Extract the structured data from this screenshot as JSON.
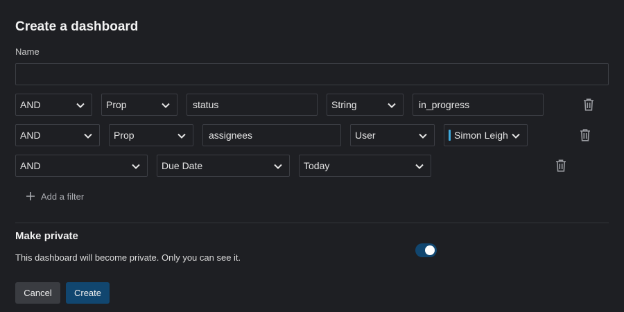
{
  "dialog": {
    "title": "Create a dashboard",
    "name_label": "Name",
    "name_value": "",
    "name_placeholder": ""
  },
  "filters": [
    {
      "conjunction": "AND",
      "kind": "Prop",
      "property": "status",
      "type": "String",
      "value": "in_progress"
    },
    {
      "conjunction": "AND",
      "kind": "Prop",
      "property": "assignees",
      "type": "User",
      "value": "Simon Leigh",
      "value_color": "#3ea9dc"
    },
    {
      "conjunction": "AND",
      "kind": "Due Date",
      "value": "Today"
    }
  ],
  "add_filter_label": "Add a filter",
  "private": {
    "title": "Make private",
    "description": "This dashboard will become private. Only you can see it.",
    "enabled": true
  },
  "buttons": {
    "cancel": "Cancel",
    "create": "Create"
  },
  "colors": {
    "background": "#1e1f23",
    "border": "#3c3e44",
    "primary": "#11466f",
    "secondary_button": "#3a3c41",
    "accent": "#3ea9dc"
  },
  "icons": {
    "dropdown": "chevron-down-icon",
    "delete": "trash-icon",
    "add": "plus-icon"
  }
}
